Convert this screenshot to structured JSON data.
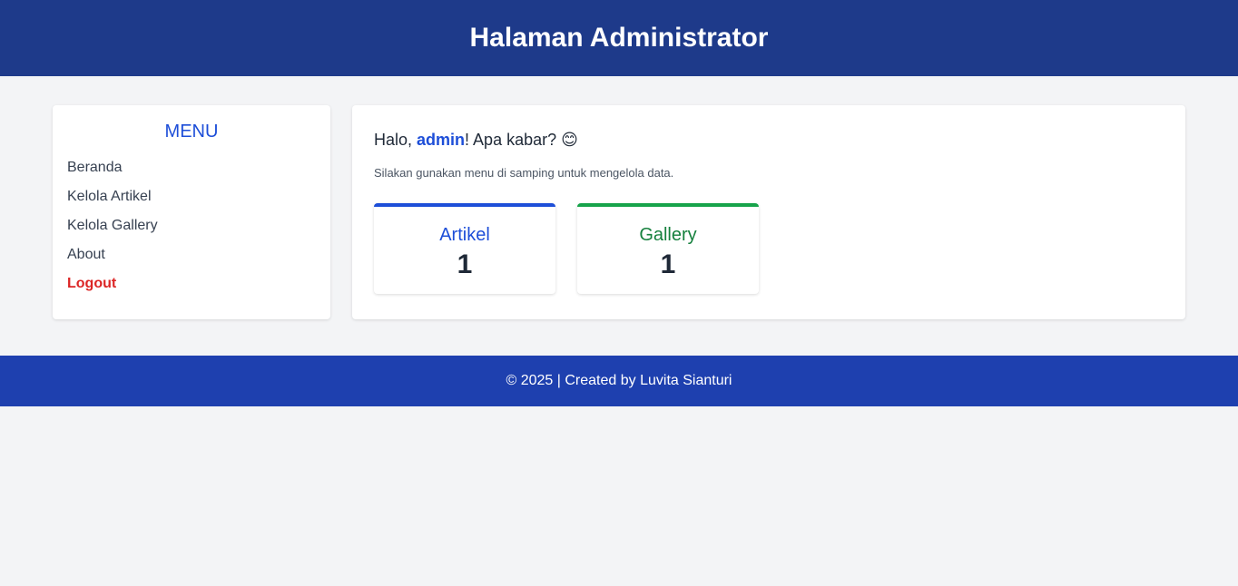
{
  "header": {
    "title": "Halaman Administrator"
  },
  "sidebar": {
    "title": "MENU",
    "items": [
      {
        "label": "Beranda"
      },
      {
        "label": "Kelola Artikel"
      },
      {
        "label": "Kelola Gallery"
      },
      {
        "label": "About"
      },
      {
        "label": "Logout"
      }
    ]
  },
  "content": {
    "greeting_prefix": "Halo, ",
    "username": "admin",
    "greeting_suffix": "! Apa kabar? 😊",
    "subtext": "Silakan gunakan menu di samping untuk mengelola data.",
    "stats": [
      {
        "label": "Artikel",
        "value": "1",
        "color": "#1d4ed8"
      },
      {
        "label": "Gallery",
        "value": "1",
        "color": "#16a34a"
      }
    ]
  },
  "footer": {
    "text": "© 2025 | Created by Luvita Sianturi"
  },
  "colors": {
    "header_bg": "#1e3a8a",
    "footer_bg": "#1e40af",
    "accent_blue": "#1d4ed8",
    "accent_green": "#16a34a",
    "logout_red": "#dc2626"
  }
}
